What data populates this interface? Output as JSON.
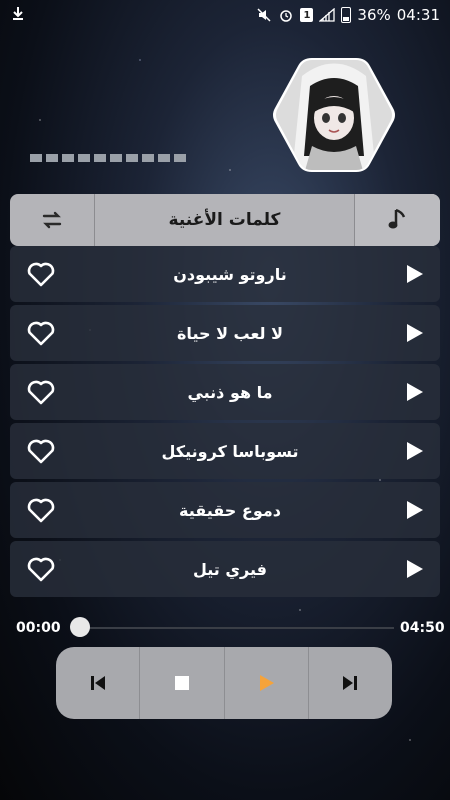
{
  "status_bar": {
    "battery_percent": "36%",
    "time": "04:31",
    "notification_count": "1"
  },
  "header": {
    "title": "كلمات الأغنية"
  },
  "songs": [
    {
      "title": "ناروتو شيبودن"
    },
    {
      "title": "لا لعب لا حياة"
    },
    {
      "title": "ما هو ذنبي"
    },
    {
      "title": "تسوباسا كرونيكل"
    },
    {
      "title": "دموع حقيقية"
    },
    {
      "title": "فيري تيل"
    }
  ],
  "player": {
    "current_time": "00:00",
    "total_time": "04:50",
    "progress": 0.0
  },
  "colors": {
    "play_accent": "#f5a33a",
    "bar_bg": "#b4b4b8",
    "row_bg": "#282e3a"
  }
}
